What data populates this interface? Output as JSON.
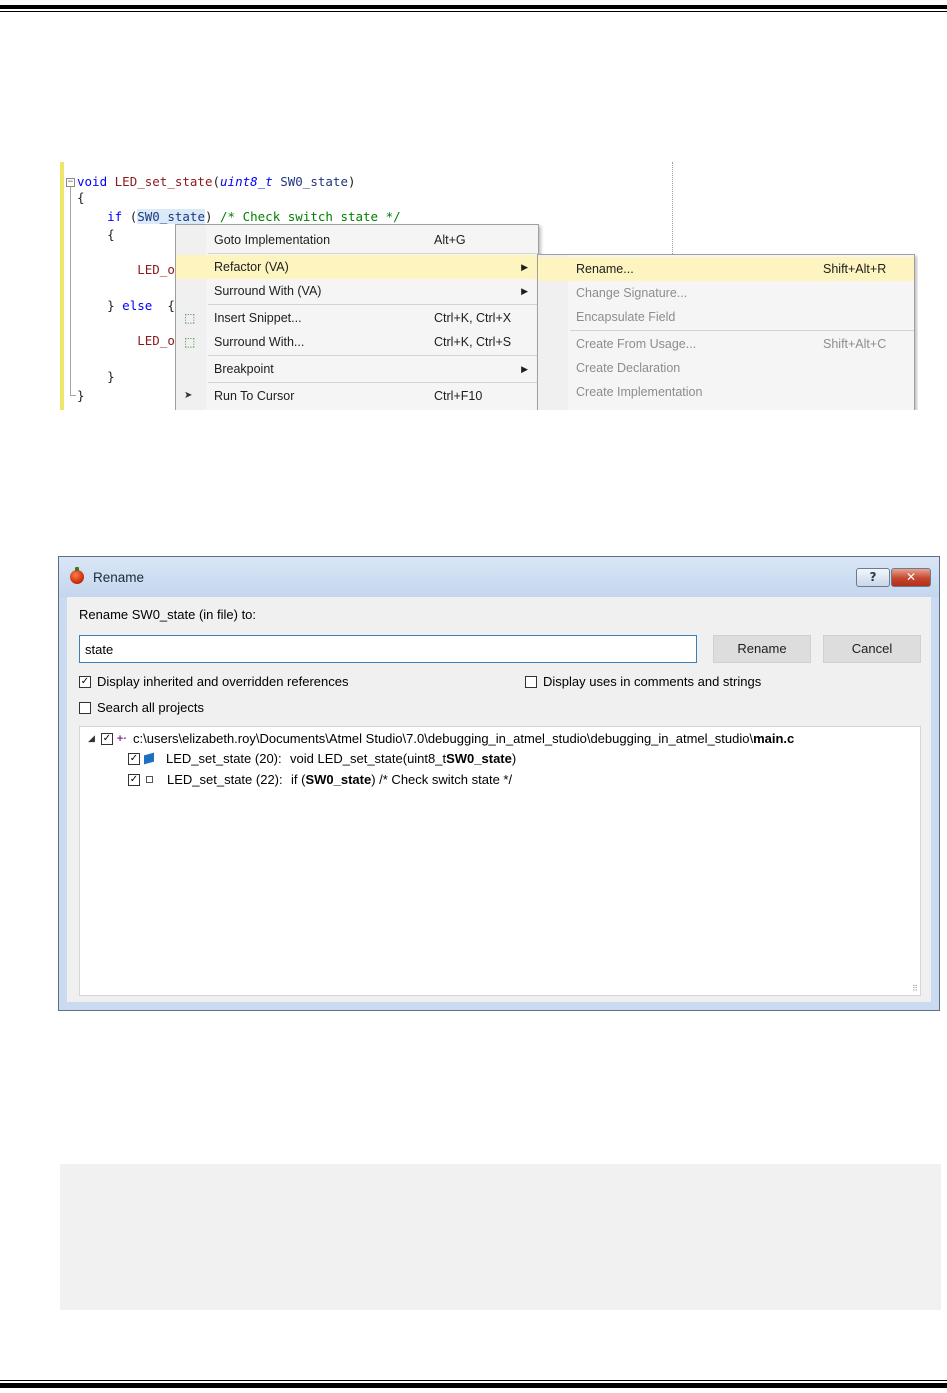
{
  "editor": {
    "code": {
      "l1_void": "void",
      "l1_fn": "LED_set_state",
      "l1_open": "(",
      "l1_type": "uint8_t",
      "l1_param": "SW0_state",
      "l1_close": ")",
      "l2": "{",
      "l3_if": "if",
      "l3_open": " (",
      "l3_param": "SW0_state",
      "l3_close": ") ",
      "l3_comment": "/* Check switch state */",
      "l4": "{",
      "l5": "LED_o",
      "l6_brace": "} ",
      "l6_else": "else",
      "l6_rest": "  {",
      "l7": "LED_o",
      "l8": "}",
      "l9": "}",
      "collapse_glyph": "−"
    },
    "context_menu": [
      {
        "label": "Goto Implementation",
        "shortcut": "Alt+G",
        "icon": "",
        "arrow": ""
      },
      {
        "label": "Refactor (VA)",
        "shortcut": "",
        "icon": "",
        "arrow": "▶"
      },
      {
        "label": "Surround With (VA)",
        "shortcut": "",
        "icon": "",
        "arrow": "▶"
      },
      {
        "label": "Insert Snippet...",
        "shortcut": "Ctrl+K, Ctrl+X",
        "icon": "snippet-icon",
        "arrow": ""
      },
      {
        "label": "Surround With...",
        "shortcut": "Ctrl+K, Ctrl+S",
        "icon": "snippet-icon",
        "arrow": ""
      },
      {
        "label": "Breakpoint",
        "shortcut": "",
        "icon": "",
        "arrow": "▶"
      },
      {
        "label": "Run To Cursor",
        "shortcut": "Ctrl+F10",
        "icon": "cursor-icon",
        "arrow": ""
      }
    ],
    "submenu": [
      {
        "label": "Rename...",
        "shortcut": "Shift+Alt+R"
      },
      {
        "label": "Change Signature...",
        "shortcut": ""
      },
      {
        "label": "Encapsulate Field",
        "shortcut": ""
      },
      {
        "label": "Create From Usage...",
        "shortcut": "Shift+Alt+C"
      },
      {
        "label": "Create Declaration",
        "shortcut": ""
      },
      {
        "label": "Create Implementation",
        "shortcut": ""
      }
    ],
    "icons": {
      "snippet": "⬚",
      "cursor": "➤"
    }
  },
  "dialog": {
    "title": "Rename",
    "help_glyph": "?",
    "close_glyph": "✕",
    "prompt": "Rename SW0_state (in file) to:",
    "input_value": "state",
    "rename_button": "Rename",
    "cancel_button": "Cancel",
    "options": {
      "inherited": {
        "label": "Display inherited and overridden references",
        "checked": true
      },
      "comments": {
        "label": "Display uses in comments and strings",
        "checked": false
      },
      "all_projects": {
        "label": "Search all projects",
        "checked": false
      }
    },
    "check_glyph": "✓",
    "results": {
      "expand_glyph": "◢",
      "va_glyph": "+·",
      "file_prefix": "c:\\users\\elizabeth.roy\\Documents\\Atmel Studio\\7.0\\debugging_in_atmel_studio\\debugging_in_atmel_studio\\",
      "file_name": "main.c",
      "rows": [
        {
          "ref": "LED_set_state (20):",
          "pre": "void LED_set_state(uint8_t ",
          "bold": "SW0_state",
          "post": ")"
        },
        {
          "ref": "LED_set_state (22):",
          "pre": "if (",
          "bold": "SW0_state",
          "post": ") /* Check switch state */"
        }
      ]
    },
    "grip_glyph": "⠿"
  },
  "colors": {
    "menu_highlight": "#fdf4bf",
    "dialog_frame": "#c9daf1",
    "input_border": "#3c7fb1",
    "keyword": "#0000ff",
    "comment": "#008000"
  }
}
